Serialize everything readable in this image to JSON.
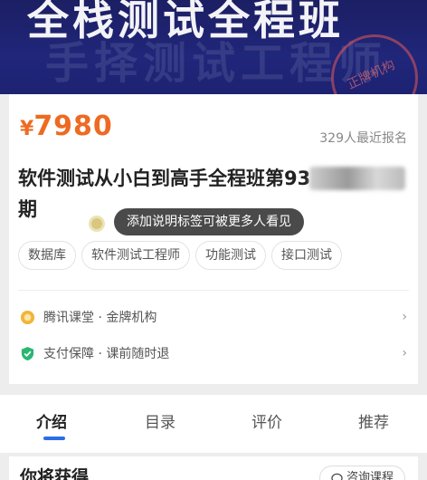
{
  "banner": {
    "title": "全栈测试全程班",
    "shadow_title": "手择测试工程师",
    "seal_text": "正牌机构"
  },
  "course": {
    "price_symbol": "¥",
    "price": "7980",
    "enroll_count": "329人最近报名",
    "title": "软件测试从小白到高手全程班第93期",
    "tooltip": "添加说明标签可被更多人看见",
    "tags": [
      "数据库",
      "软件测试工程师",
      "功能测试",
      "接口测试"
    ],
    "institution": "腾讯课堂 · 金牌机构",
    "guarantee": "支付保障 · 课前随时退"
  },
  "tabs": [
    "介绍",
    "目录",
    "评价",
    "推荐"
  ],
  "bottom": {
    "section_title": "你将获得",
    "consult_label": "咨询课程"
  },
  "colors": {
    "price": "#ee6a22",
    "accent": "#2b6de8",
    "banner": "#1c1f63"
  }
}
